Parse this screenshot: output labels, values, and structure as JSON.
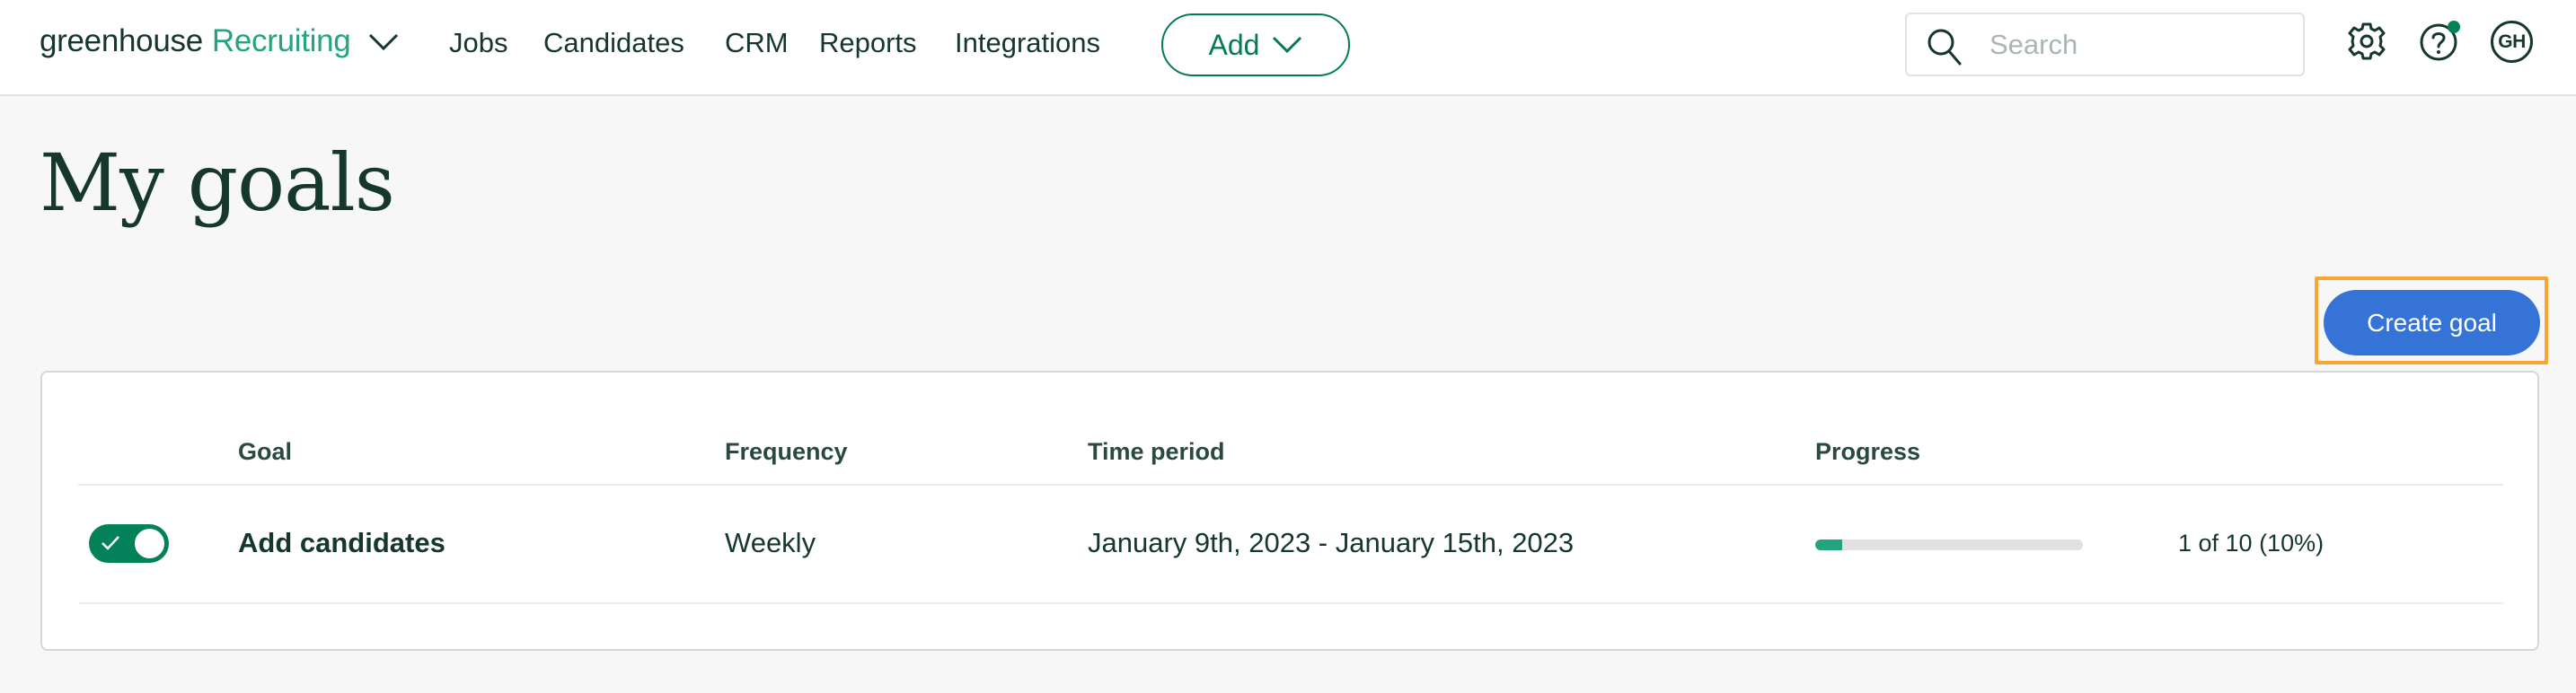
{
  "nav": {
    "logo_primary": "greenhouse",
    "logo_secondary": "Recruiting",
    "logo_menu_icon": "chevron-down-icon",
    "links": [
      {
        "label": "Jobs"
      },
      {
        "label": "Candidates"
      },
      {
        "label": "CRM"
      },
      {
        "label": "Reports"
      },
      {
        "label": "Integrations"
      }
    ],
    "add_button": {
      "label": "Add",
      "icon": "chevron-down-icon"
    },
    "search": {
      "placeholder": "Search",
      "value": "",
      "icon": "search-icon"
    },
    "settings_icon": "gear-icon",
    "help_icon": "help-circle-icon",
    "help_has_notification": true,
    "avatar_initials": "GH"
  },
  "page": {
    "title": "My goals",
    "create_button_label": "Create goal"
  },
  "table": {
    "columns": [
      "Goal",
      "Frequency",
      "Time period",
      "Progress"
    ],
    "rows": [
      {
        "enabled": true,
        "goal": "Add candidates",
        "frequency": "Weekly",
        "time_period": "January 9th, 2023 - January 15th, 2023",
        "progress_current": 1,
        "progress_target": 10,
        "progress_fraction": 0.1,
        "progress_label": "1 of 10 (10%)"
      }
    ]
  },
  "colors": {
    "brand_dark": "#15372c",
    "brand_green": "#24a47f",
    "accent_green": "#038259",
    "primary_button": "#3574d6",
    "highlight": "#f8a532",
    "background": "#f7f7f7"
  }
}
